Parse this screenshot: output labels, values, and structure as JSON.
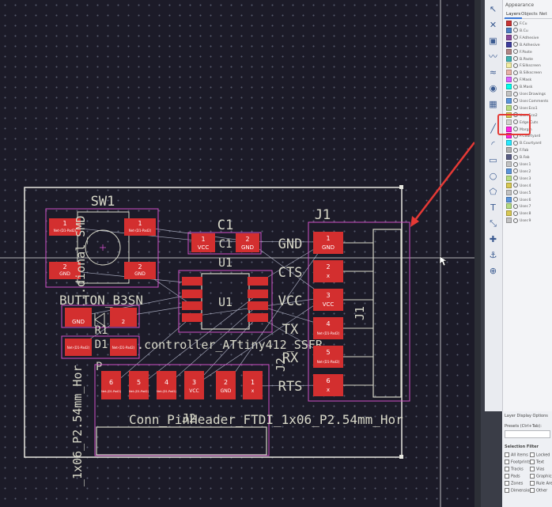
{
  "panel": {
    "title": "Appearance",
    "tabs": [
      "Layers",
      "Objects",
      "Net"
    ],
    "layers": [
      {
        "name": "F.Cu",
        "color": "#c83434"
      },
      {
        "name": "B.Cu",
        "color": "#4d7fc4"
      },
      {
        "name": "F.Adhesive",
        "color": "#8b4a9c"
      },
      {
        "name": "B.Adhesive",
        "color": "#3d3d9e"
      },
      {
        "name": "F.Paste",
        "color": "#b08686"
      },
      {
        "name": "B.Paste",
        "color": "#3fb2b2"
      },
      {
        "name": "F.Silkscreen",
        "color": "#f2eda1"
      },
      {
        "name": "B.Silkscreen",
        "color": "#e8b2a7"
      },
      {
        "name": "F.Mask",
        "color": "#d864ff"
      },
      {
        "name": "B.Mask",
        "color": "#02ffee"
      },
      {
        "name": "User.Drawings",
        "color": "#c2c2c2"
      },
      {
        "name": "User.Comments",
        "color": "#5994dc"
      },
      {
        "name": "User.Eco1",
        "color": "#b4db80"
      },
      {
        "name": "User.Eco2",
        "color": "#d8c852"
      },
      {
        "name": "Edge.Cuts",
        "color": "#d0d2cd"
      },
      {
        "name": "Margin",
        "color": "#ff26e2"
      },
      {
        "name": "F.Courtyard",
        "color": "#ff26e2"
      },
      {
        "name": "B.Courtyard",
        "color": "#26e9ff"
      },
      {
        "name": "F.Fab",
        "color": "#afafaf"
      },
      {
        "name": "B.Fab",
        "color": "#585d84"
      },
      {
        "name": "User.1",
        "color": "#c2c2c2"
      },
      {
        "name": "User.2",
        "color": "#5994dc"
      },
      {
        "name": "User.3",
        "color": "#b4db80"
      },
      {
        "name": "User.4",
        "color": "#d8c852"
      },
      {
        "name": "User.5",
        "color": "#c2c2c2"
      },
      {
        "name": "User.6",
        "color": "#5994dc"
      },
      {
        "name": "User.7",
        "color": "#b4db80"
      },
      {
        "name": "User.8",
        "color": "#d8c852"
      },
      {
        "name": "User.9",
        "color": "#c2c2c2"
      }
    ],
    "layer_display_options": "Layer Display Options",
    "presets": "Presets (Ctrl+Tab):",
    "selection_filter": "Selection Filter",
    "filters": [
      "All items",
      "Footprints",
      "Tracks",
      "Pads",
      "Zones",
      "Dimensions",
      "Locked",
      "Text",
      "Vias",
      "Graphics",
      "Rule Areas",
      "Other"
    ]
  },
  "pcb": {
    "refs": {
      "sw1": "SW1",
      "c1": "C1",
      "j1": "J1",
      "u1": "U1",
      "j1_vertical": "J1",
      "j2": "J2",
      "r1": "R1",
      "d1": "D1"
    },
    "values": {
      "sw1_value": "BUTTON_B3SN",
      "sw1_value_vertical": "...dional_SMD",
      "u1_value": "...controller_ATtiny412_SSFR",
      "j2_value": "Conn_PinHeader_FTDI_1x06_P2.54mm_Hor",
      "j2_value_vertical": "_1x06_P2.54mm_Hor",
      "fragment_p": "P"
    },
    "j1_pins": [
      "GND",
      "CTS",
      "VCC",
      "TX",
      "RX",
      "RTS"
    ],
    "pad_numbers": [
      "1",
      "2",
      "3",
      "4",
      "5",
      "6"
    ],
    "pad_nets": {
      "gnd": "GND",
      "vcc": "VCC",
      "x": "x",
      "tx": "TX",
      "rx": "RX",
      "net": "Net-(D1-Pad2)"
    }
  }
}
